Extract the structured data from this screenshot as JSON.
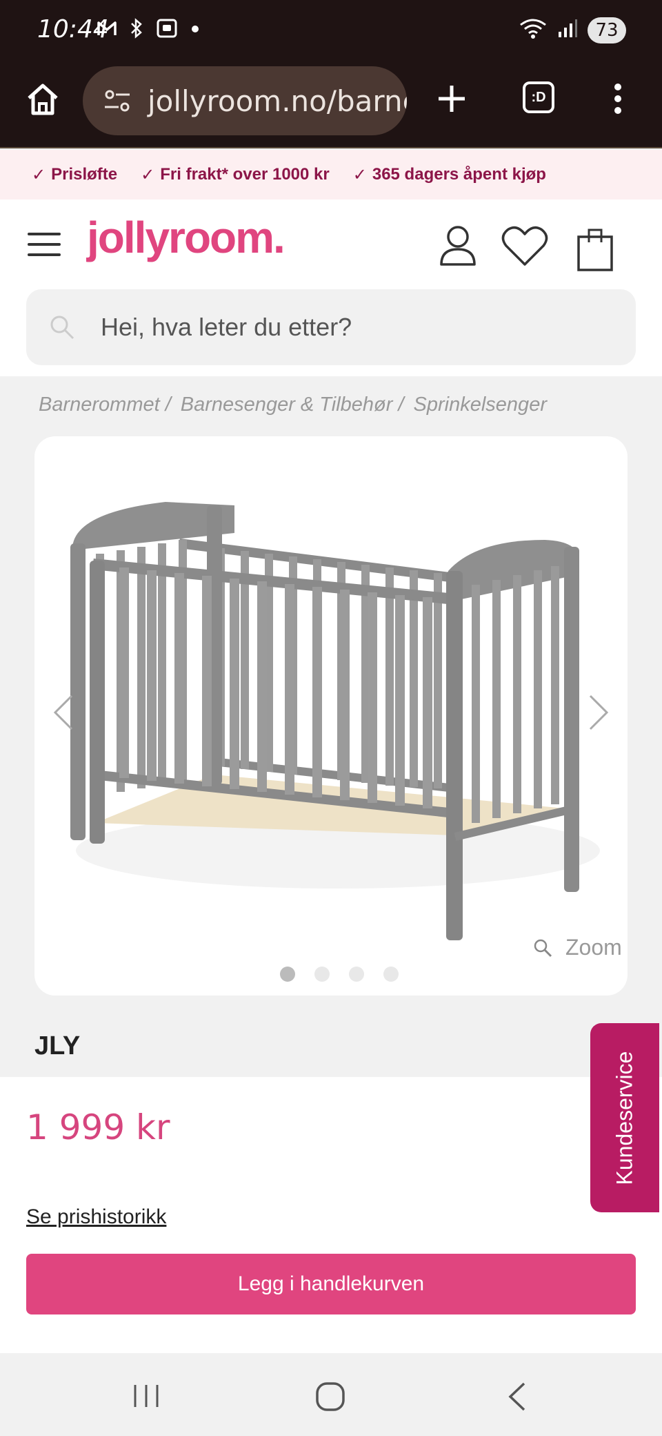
{
  "status_bar": {
    "time": "10:44",
    "battery": "73",
    "icons": [
      "gmail-icon",
      "bluetooth-icon",
      "screenshot-icon",
      "dot-icon",
      "wifi-icon",
      "signal-icon"
    ]
  },
  "browser": {
    "url": "jollyroom.no/barne",
    "tabs_label": ":D"
  },
  "usp": [
    "Prisløfte",
    "Fri frakt* over 1000 kr",
    "365 dagers åpent kjøp"
  ],
  "header": {
    "logo": "jollyroom.",
    "search_placeholder": "Hei, hva leter du etter?"
  },
  "breadcrumb": [
    "Barnerommet /",
    "Barnesenger & Tilbehør /",
    "Sprinkelsenger"
  ],
  "product": {
    "zoom_label": "Zoom",
    "image_count": 4,
    "active_image": 1,
    "brand": "JLY",
    "price": "1 999 kr",
    "history_link": "Se prishistorikk",
    "add_to_cart": "Legg i handlekurven"
  },
  "customer_service": "Kundeservice",
  "colors": {
    "accent": "#e0457f",
    "price": "#d6457e",
    "usp_text": "#8c1548",
    "customer_service_bg": "#b81c63",
    "browser_bg": "#1f1313"
  }
}
